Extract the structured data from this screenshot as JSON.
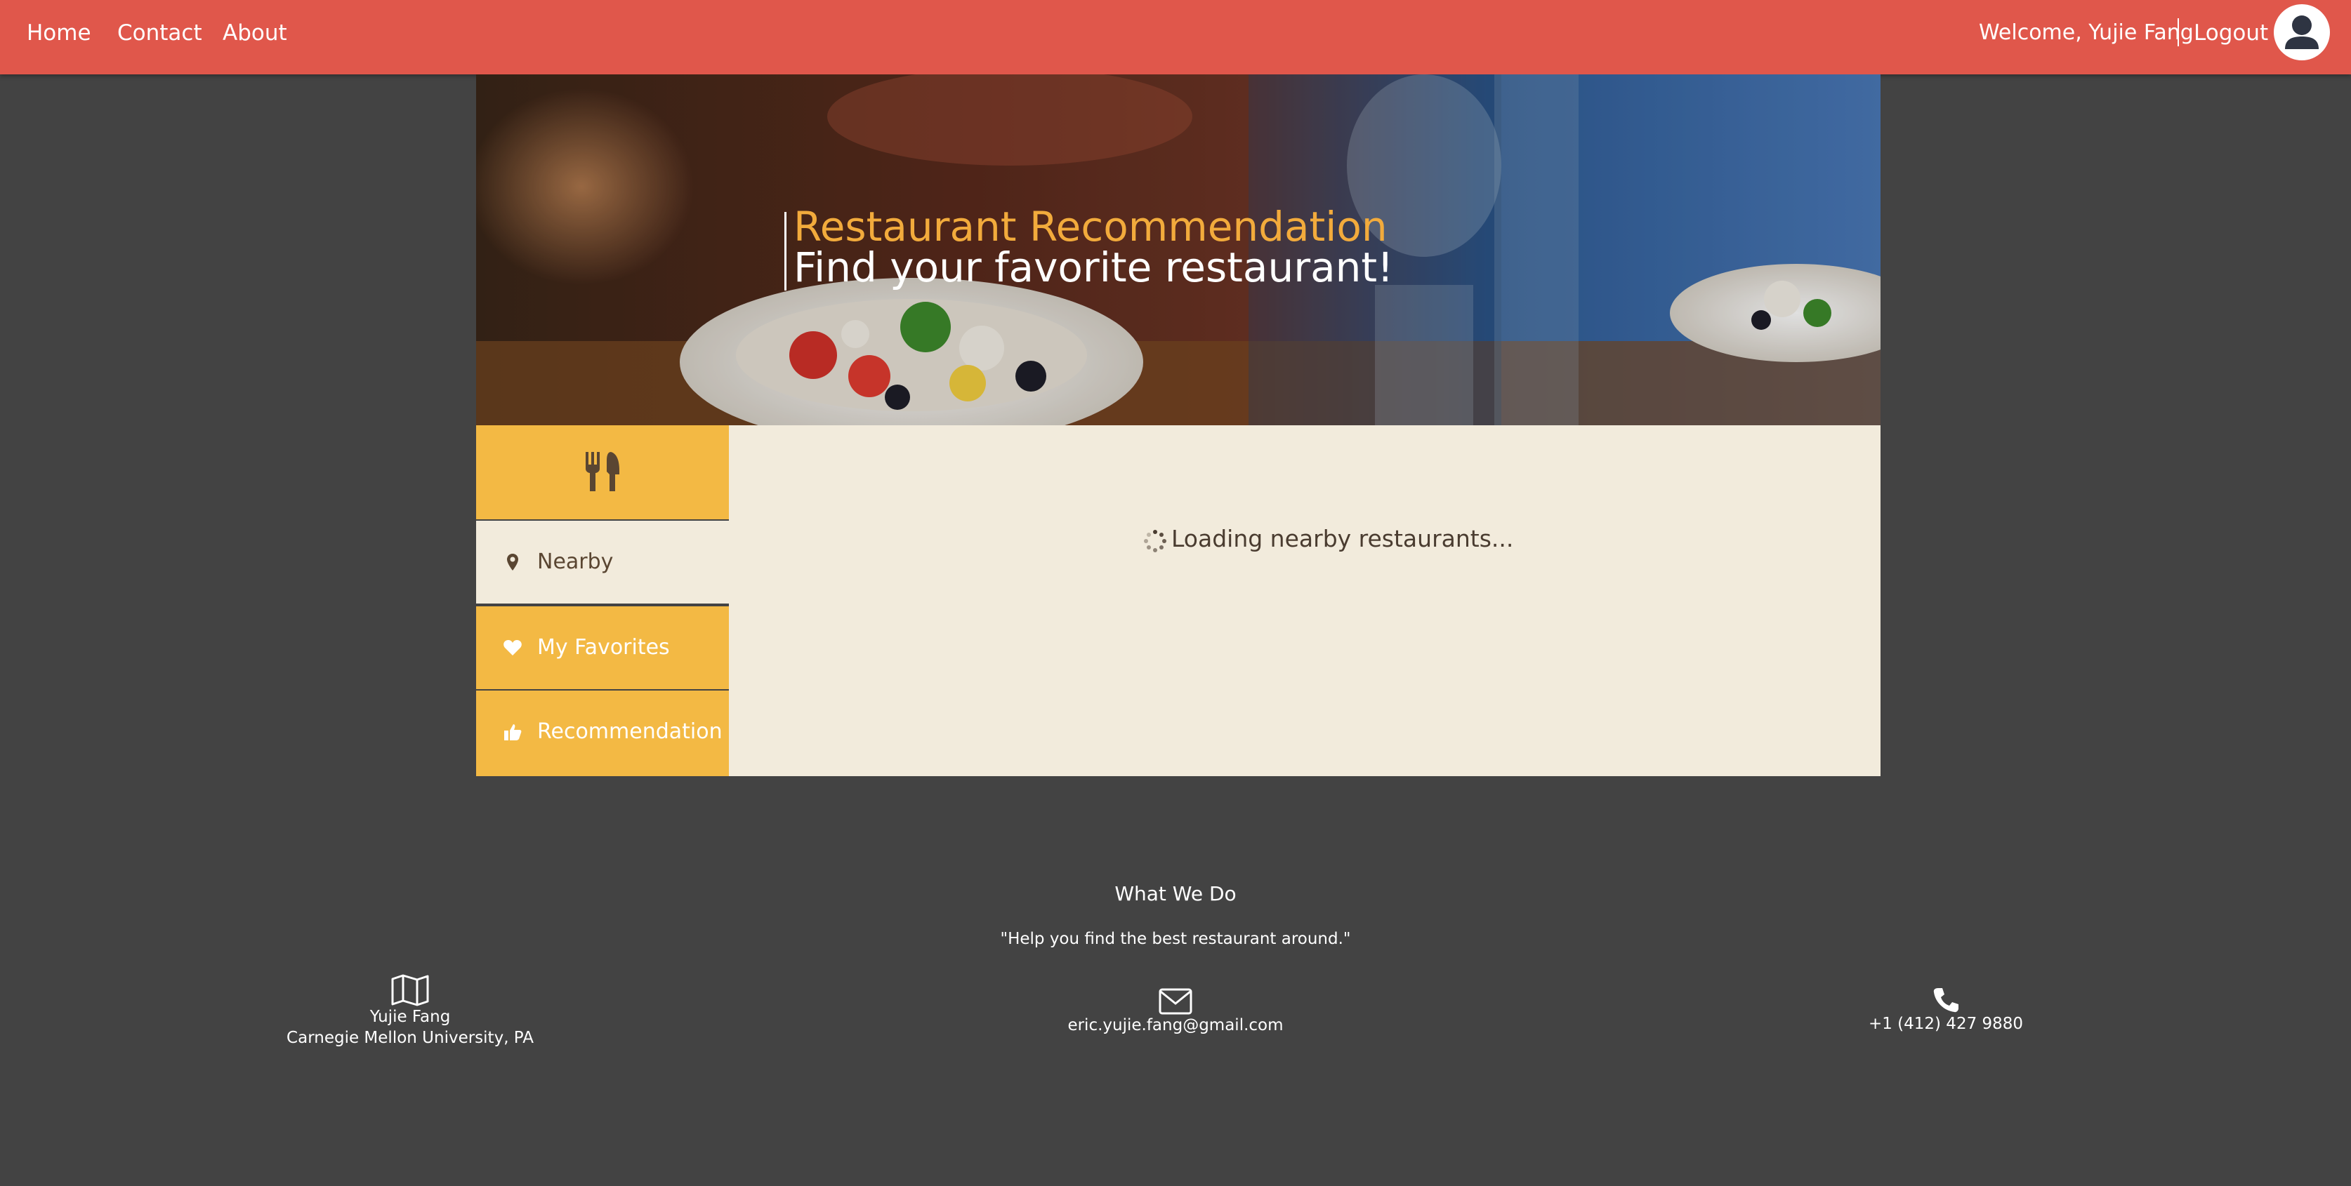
{
  "nav": {
    "home": "Home",
    "contact": "Contact",
    "about": "About",
    "welcome": "Welcome, Yujie Fang",
    "logout": "Logout",
    "avatar_icon": "user-avatar-icon"
  },
  "hero": {
    "title": "Restaurant Recommendation",
    "subtitle": "Find your favorite restaurant!"
  },
  "side_menu": {
    "header_icon": "utensils-icon",
    "items": [
      {
        "label": "Nearby",
        "icon": "map-pin-icon",
        "active": true
      },
      {
        "label": "My Favorites",
        "icon": "heart-icon",
        "active": false
      },
      {
        "label": "Recommendation",
        "icon": "thumbs-up-icon",
        "active": false
      }
    ]
  },
  "content": {
    "loading_text": "Loading nearby restaurants..."
  },
  "footer": {
    "title": "What We Do",
    "quote": "\"Help you find the best restaurant around.\"",
    "address": {
      "icon": "map-icon",
      "name": "Yujie Fang",
      "place": "Carnegie Mellon University, PA"
    },
    "email": {
      "icon": "envelope-icon",
      "value": "eric.yujie.fang@gmail.com"
    },
    "phone": {
      "icon": "phone-icon",
      "value": "+1 (412) 427 9880"
    }
  },
  "colors": {
    "nav_bg": "#e0574b",
    "page_bg": "#434343",
    "accent_yellow": "#f3b944",
    "title_orange": "#f2ab3c",
    "content_bg": "#f2ebdc"
  }
}
